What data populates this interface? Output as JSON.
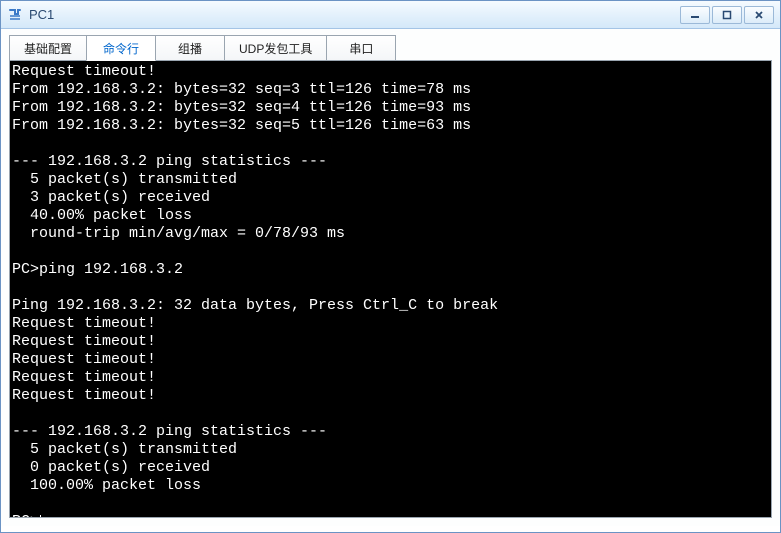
{
  "window": {
    "title": "PC1"
  },
  "tabs": [
    {
      "label": "基础配置",
      "active": false
    },
    {
      "label": "命令行",
      "active": true
    },
    {
      "label": "组播",
      "active": false
    },
    {
      "label": "UDP发包工具",
      "active": false
    },
    {
      "label": "串口",
      "active": false
    }
  ],
  "terminal": {
    "lines": [
      "Request timeout!",
      "From 192.168.3.2: bytes=32 seq=3 ttl=126 time=78 ms",
      "From 192.168.3.2: bytes=32 seq=4 ttl=126 time=93 ms",
      "From 192.168.3.2: bytes=32 seq=5 ttl=126 time=63 ms",
      "",
      "--- 192.168.3.2 ping statistics ---",
      "  5 packet(s) transmitted",
      "  3 packet(s) received",
      "  40.00% packet loss",
      "  round-trip min/avg/max = 0/78/93 ms",
      "",
      "PC>ping 192.168.3.2",
      "",
      "Ping 192.168.3.2: 32 data bytes, Press Ctrl_C to break",
      "Request timeout!",
      "Request timeout!",
      "Request timeout!",
      "Request timeout!",
      "Request timeout!",
      "",
      "--- 192.168.3.2 ping statistics ---",
      "  5 packet(s) transmitted",
      "  0 packet(s) received",
      "  100.00% packet loss",
      ""
    ],
    "prompt": "PC>"
  }
}
